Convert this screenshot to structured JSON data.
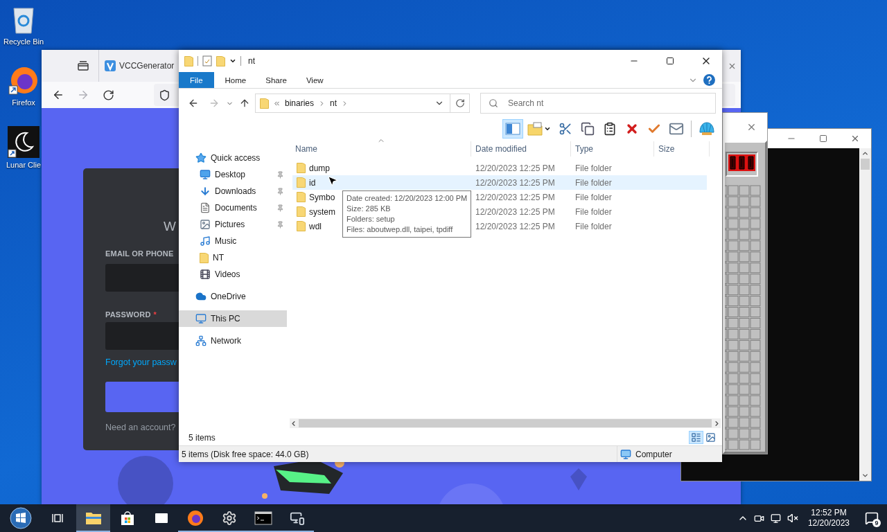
{
  "desktop_icons": [
    {
      "kind": "recycle-bin",
      "label": "Recycle Bin"
    },
    {
      "kind": "firefox",
      "label": "Firefox"
    },
    {
      "kind": "lunar",
      "label": "Lunar Clie"
    }
  ],
  "browser": {
    "tab_title": "VCCGenerator",
    "login": {
      "heading": "W",
      "email_label": "EMAIL OR PHONE",
      "password_label": "PASSWORD",
      "required_mark": "*",
      "forgot_link": "Forgot your passw",
      "register_prompt": "Need an account?"
    }
  },
  "explorer": {
    "title": "nt",
    "ribbon_tabs": [
      {
        "label": "File",
        "selected": true
      },
      {
        "label": "Home",
        "selected": false
      },
      {
        "label": "Share",
        "selected": false
      },
      {
        "label": "View",
        "selected": false
      }
    ],
    "breadcrumb": [
      "binaries",
      "nt"
    ],
    "search": {
      "placeholder": "Search nt"
    },
    "toolbar": [
      {
        "kind": "preview-pane",
        "selected": true
      },
      {
        "kind": "new-folder",
        "selected": false
      },
      {
        "kind": "cut",
        "selected": false
      },
      {
        "kind": "copy",
        "selected": false
      },
      {
        "kind": "paste",
        "selected": false
      },
      {
        "kind": "delete",
        "selected": false
      },
      {
        "kind": "check",
        "selected": false
      },
      {
        "kind": "mail",
        "selected": false
      },
      {
        "kind": "shell",
        "selected": false
      }
    ],
    "nav": [
      {
        "kind": "star",
        "label": "Quick access",
        "selected": false,
        "children": [
          {
            "kind": "desktop",
            "label": "Desktop",
            "pinned": true,
            "selected": false
          },
          {
            "kind": "downloads",
            "label": "Downloads",
            "pinned": true,
            "selected": false
          },
          {
            "kind": "documents",
            "label": "Documents",
            "pinned": true,
            "selected": false
          },
          {
            "kind": "pictures",
            "label": "Pictures",
            "pinned": true,
            "selected": false
          },
          {
            "kind": "music",
            "label": "Music",
            "pinned": false,
            "selected": false
          },
          {
            "kind": "folder",
            "label": "NT",
            "pinned": false,
            "selected": false
          },
          {
            "kind": "videos",
            "label": "Videos",
            "pinned": false,
            "selected": false
          }
        ]
      },
      {
        "kind": "cloud",
        "label": "OneDrive",
        "selected": false
      },
      {
        "kind": "pc",
        "label": "This PC",
        "selected": true
      },
      {
        "kind": "network",
        "label": "Network",
        "selected": false
      }
    ],
    "columns": [
      "Name",
      "Date modified",
      "Type",
      "Size"
    ],
    "rows": [
      {
        "name": "dump",
        "date": "12/20/2023 12:25 PM",
        "type": "File folder",
        "hovered": false
      },
      {
        "name": "id",
        "date": "12/20/2023 12:25 PM",
        "type": "File folder",
        "hovered": true
      },
      {
        "name": "Symbo",
        "date": "12/20/2023 12:25 PM",
        "type": "File folder",
        "hovered": false
      },
      {
        "name": "system",
        "date": "12/20/2023 12:25 PM",
        "type": "File folder",
        "hovered": false
      },
      {
        "name": "wdl",
        "date": "12/20/2023 12:25 PM",
        "type": "File folder",
        "hovered": false
      }
    ],
    "tooltip": [
      "Date created: 12/20/2023 12:00 PM",
      "Size: 285 KB",
      "Folders: setup",
      "Files: aboutwep.dll, taipei, tpdiff"
    ],
    "item_count": "5 items",
    "view_modes": [
      {
        "kind": "details",
        "selected": true
      },
      {
        "kind": "large-icons",
        "selected": false
      }
    ],
    "status": {
      "text": "5 items (Disk free space: 44.0 GB)",
      "location": "Computer"
    }
  },
  "taskbar": {
    "apps": [
      {
        "kind": "explorer",
        "active": true,
        "running": true
      },
      {
        "kind": "store",
        "active": false,
        "running": false
      },
      {
        "kind": "mail",
        "active": false,
        "running": false
      },
      {
        "kind": "firefox",
        "active": false,
        "running": true
      },
      {
        "kind": "settings",
        "active": false,
        "running": true
      },
      {
        "kind": "terminal",
        "active": false,
        "running": true
      },
      {
        "kind": "monitor",
        "active": false,
        "running": true
      }
    ],
    "time": "12:52 PM",
    "date": "12/20/2023",
    "notifications": "9"
  }
}
